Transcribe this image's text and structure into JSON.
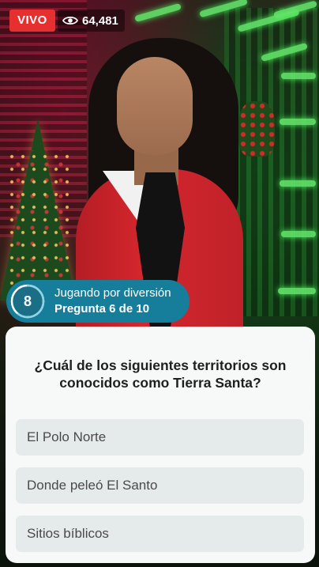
{
  "stream": {
    "live_label": "VIVO",
    "viewer_count": "64,481",
    "viewer_icon": "eye-icon"
  },
  "game": {
    "round_number": "8",
    "round_progress": 0.6,
    "mode_label": "Jugando por diversión",
    "question_counter": "Pregunta 6 de 10",
    "accent_color": "#167e9a"
  },
  "question": {
    "text": "¿Cuál de los siguientes territorios son conocidos como Tierra Santa?",
    "answers": [
      {
        "label": "El Polo Norte"
      },
      {
        "label": "Donde peleó El Santo"
      },
      {
        "label": "Sitios bíblicos"
      }
    ]
  },
  "colors": {
    "live_red": "#e62f2f",
    "card_background": "#f7f9f8",
    "answer_background": "#e5ebea"
  }
}
